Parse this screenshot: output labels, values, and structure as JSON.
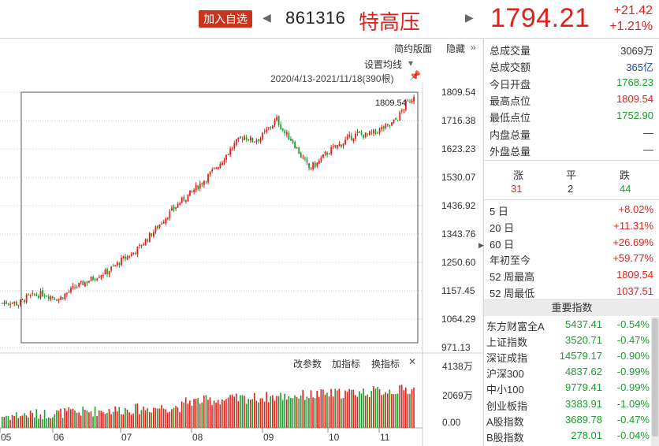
{
  "header": {
    "add_button": "加入自选",
    "prev_arrow": "◀",
    "next_arrow": "▶",
    "code": "861316",
    "name": "特高压",
    "price": "1794.21",
    "change": "+21.42",
    "change_pct": "+1.21%"
  },
  "chart_toolbar": {
    "simple_layout": "简约版面",
    "hide": "隐藏",
    "set_ma": "设置均线",
    "range": "2020/4/13-2021/11/18(390根)",
    "max_label": "1809.54",
    "modify_params": "改参数",
    "add_indicator": "加指标",
    "switch_indicator": "换指标",
    "close": "✕"
  },
  "chart_data": {
    "type": "candlestick",
    "y_ticks": [
      "1809.54",
      "1716.38",
      "1623.23",
      "1530.07",
      "1436.92",
      "1343.76",
      "1250.60",
      "1157.45",
      "1064.29",
      "971.13"
    ],
    "ylim": [
      971.13,
      1809.54
    ],
    "volume_ticks": [
      "4138万",
      "2069万",
      "0.00"
    ],
    "x_labels": [
      "05",
      "06",
      "07",
      "08",
      "09",
      "10",
      "11"
    ],
    "max_price": 1809.54,
    "last_close": 1794.21,
    "colors": {
      "up": "#e0211b",
      "down": "#1b9e2e"
    },
    "price_path": [
      [
        0,
        1117
      ],
      [
        4,
        1121
      ],
      [
        8,
        1114
      ],
      [
        12,
        1135
      ],
      [
        16,
        1142
      ],
      [
        20,
        1148
      ],
      [
        24,
        1140
      ],
      [
        28,
        1130
      ],
      [
        32,
        1150
      ],
      [
        36,
        1168
      ],
      [
        40,
        1182
      ],
      [
        44,
        1195
      ],
      [
        48,
        1210
      ],
      [
        52,
        1220
      ],
      [
        56,
        1240
      ],
      [
        60,
        1262
      ],
      [
        64,
        1278
      ],
      [
        68,
        1300
      ],
      [
        72,
        1330
      ],
      [
        76,
        1360
      ],
      [
        80,
        1392
      ],
      [
        84,
        1420
      ],
      [
        88,
        1448
      ],
      [
        92,
        1470
      ],
      [
        96,
        1495
      ],
      [
        100,
        1520
      ],
      [
        104,
        1548
      ],
      [
        108,
        1578
      ],
      [
        112,
        1612
      ],
      [
        116,
        1645
      ],
      [
        120,
        1665
      ],
      [
        124,
        1650
      ],
      [
        128,
        1660
      ],
      [
        132,
        1690
      ],
      [
        136,
        1720
      ],
      [
        140,
        1675
      ],
      [
        144,
        1648
      ],
      [
        148,
        1600
      ],
      [
        152,
        1560
      ],
      [
        156,
        1575
      ],
      [
        160,
        1605
      ],
      [
        164,
        1625
      ],
      [
        168,
        1640
      ],
      [
        172,
        1660
      ],
      [
        176,
        1672
      ],
      [
        180,
        1668
      ],
      [
        184,
        1675
      ],
      [
        188,
        1690
      ],
      [
        192,
        1700
      ],
      [
        196,
        1725
      ],
      [
        200,
        1770
      ],
      [
        204,
        1794.21
      ]
    ]
  },
  "stats": [
    {
      "label": "总成交量",
      "value": "3069万",
      "color": "#333333"
    },
    {
      "label": "总成交额",
      "value": "365亿",
      "color": "#1d4fa3"
    },
    {
      "label": "今日开盘",
      "value": "1768.23",
      "color": "#1b9e2e"
    },
    {
      "label": "最高点位",
      "value": "1809.54",
      "color": "#e0211b"
    },
    {
      "label": "最低点位",
      "value": "1752.90",
      "color": "#1b9e2e"
    },
    {
      "label": "内盘总量",
      "value": "—",
      "color": "#333333"
    },
    {
      "label": "外盘总量",
      "value": "—",
      "color": "#333333"
    }
  ],
  "breadth": {
    "up_label": "涨",
    "flat_label": "平",
    "down_label": "跌",
    "up": "31",
    "flat": "2",
    "down": "44"
  },
  "periods": [
    {
      "label": "5 日",
      "value": "+8.02%"
    },
    {
      "label": "20 日",
      "value": "+11.31%"
    },
    {
      "label": "60 日",
      "value": "+26.69%"
    },
    {
      "label": "年初至今",
      "value": "+59.77%"
    },
    {
      "label": "52 周最高",
      "value": "1809.54"
    },
    {
      "label": "52 周最低",
      "value": "1037.51"
    }
  ],
  "indices_title": "重要指数",
  "indices": [
    {
      "name": "东方财富全A",
      "price": "5437.41",
      "change": "-0.54%"
    },
    {
      "name": "上证指数",
      "price": "3520.71",
      "change": "-0.47%"
    },
    {
      "name": "深证成指",
      "price": "14579.17",
      "change": "-0.90%"
    },
    {
      "name": "沪深300",
      "price": "4837.62",
      "change": "-0.99%"
    },
    {
      "name": "中小100",
      "price": "9779.41",
      "change": "-0.99%"
    },
    {
      "name": "创业板指",
      "price": "3383.91",
      "change": "-1.09%"
    },
    {
      "name": "A股指数",
      "price": "3689.78",
      "change": "-0.47%"
    },
    {
      "name": "B股指数",
      "price": "278.01",
      "change": "-0.04%"
    }
  ]
}
